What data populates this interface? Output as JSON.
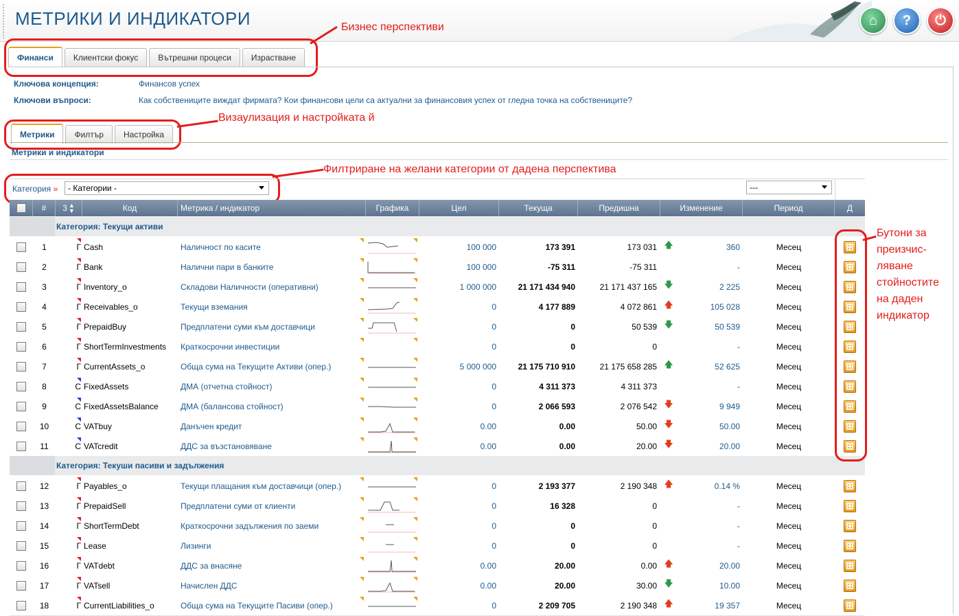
{
  "page": {
    "title": "МЕТРИКИ И ИНДИКАТОРИ"
  },
  "header_buttons": [
    {
      "name": "home",
      "glyph": "⌂"
    },
    {
      "name": "help",
      "glyph": "?"
    },
    {
      "name": "power",
      "glyph": "⏻"
    }
  ],
  "annotations": {
    "perspectives": "Бизнес перспективи",
    "visualization": "Визаулизация и настройката й",
    "filtering": "Филтриране на желани категории от дадена перспектива",
    "buttons_note": [
      "Бутони за",
      "преизчис-",
      "ляване",
      "стойностите",
      "на даден",
      "индикатор"
    ]
  },
  "perspective_tabs": [
    "Финанси",
    "Клиентски фокус",
    "Вътрешни процеси",
    "Израстване"
  ],
  "concept": {
    "key_label": "Ключова концепция:",
    "key_value": "Финансов успех",
    "questions_label": "Ключови въпроси:",
    "questions_value": "Как собствениците виждат фирмата? Кои финансови цели са актуални за финансовия успех от гледна точка на собствениците?"
  },
  "view_tabs": [
    "Метрики",
    "Филтър",
    "Настройка"
  ],
  "section_title": "Метрики и индикатори",
  "filter": {
    "label": "Категория",
    "arrow": "»",
    "category_value": "- Категории -",
    "right_value": "---"
  },
  "columns": [
    "#",
    "3",
    "Код",
    "Метрика / индикатор",
    "Графика",
    "Цел",
    "Текуща",
    "Предишна",
    "Изменение",
    "Период",
    "Д"
  ],
  "categories": [
    {
      "label": "Категория: Текущи активи",
      "rows": [
        {
          "n": "1",
          "t": "Г",
          "code": "Cash",
          "name": "Наличност по касите",
          "target": "100 000",
          "cur": "173 391",
          "prev": "173 031",
          "dir": "up",
          "chg": "360",
          "period": "Месец",
          "tri": "r",
          "spark": "cash"
        },
        {
          "n": "2",
          "t": "Г",
          "code": "Bank",
          "name": "Налични пари в банките",
          "target": "100 000",
          "cur": "-75 311",
          "prev": "-75 311",
          "dir": "",
          "chg": "-",
          "period": "Месец",
          "tri": "r",
          "spark": "bank"
        },
        {
          "n": "3",
          "t": "Г",
          "code": "Inventory_o",
          "name": "Складови Наличности (оперативни)",
          "target": "1 000 000",
          "cur": "21 171 434 940",
          "prev": "21 171 437 165",
          "dir": "down",
          "chg": "2 225",
          "period": "Месец",
          "tri": "r",
          "spark": "flat"
        },
        {
          "n": "4",
          "t": "Г",
          "code": "Receivables_o",
          "name": "Текущи вземания",
          "target": "0",
          "cur": "4 177 889",
          "prev": "4 072 861",
          "dir": "upred",
          "chg": "105 028",
          "period": "Месец",
          "tri": "r",
          "spark": "rise"
        },
        {
          "n": "5",
          "t": "Г",
          "code": "PrepaidBuy",
          "name": "Предплатени суми към доставчици",
          "target": "0",
          "cur": "0",
          "prev": "50 539",
          "dir": "down",
          "chg": "50 539",
          "period": "Месец",
          "tri": "r",
          "spark": "drop"
        },
        {
          "n": "6",
          "t": "Г",
          "code": "ShortTermInvestments",
          "name": "Краткосрочни инвестиции",
          "target": "0",
          "cur": "0",
          "prev": "0",
          "dir": "",
          "chg": "-",
          "period": "Месец",
          "tri": "r",
          "spark": "none"
        },
        {
          "n": "7",
          "t": "Г",
          "code": "CurrentAssets_o",
          "name": "Обща сума на Текущите Активи (опер.)",
          "target": "5 000 000",
          "cur": "21 175 710 910",
          "prev": "21 175 658 285",
          "dir": "up",
          "chg": "52 625",
          "period": "Месец",
          "tri": "r",
          "spark": "flat"
        },
        {
          "n": "8",
          "t": "С",
          "code": "FixedAssets",
          "name": "ДМА (отчетна стойност)",
          "target": "0",
          "cur": "4 311 373",
          "prev": "4 311 373",
          "dir": "",
          "chg": "-",
          "period": "Месец",
          "tri": "b",
          "spark": "flat"
        },
        {
          "n": "9",
          "t": "С",
          "code": "FixedAssetsBalance",
          "name": "ДМА (балансова стойност)",
          "target": "0",
          "cur": "2 066 593",
          "prev": "2 076 542",
          "dir": "downred",
          "chg": "9 949",
          "period": "Месец",
          "tri": "b",
          "spark": "flat2"
        },
        {
          "n": "10",
          "t": "С",
          "code": "VATbuy",
          "name": "Данъчен кредит",
          "target": "0.00",
          "cur": "0.00",
          "prev": "50.00",
          "dir": "downred",
          "chg": "50.00",
          "period": "Месец",
          "tri": "b",
          "spark": "peak"
        },
        {
          "n": "11",
          "t": "С",
          "code": "VATcredit",
          "name": "ДДС за възстановяване",
          "target": "0.00",
          "cur": "0.00",
          "prev": "20.00",
          "dir": "downred",
          "chg": "20.00",
          "period": "Месец",
          "tri": "b",
          "spark": "spike"
        }
      ]
    },
    {
      "label": "Категория: Текуши пасиви и задължения",
      "rows": [
        {
          "n": "12",
          "t": "Г",
          "code": "Payables_o",
          "name": "Текущи плащания към доставчици (опер.)",
          "target": "0",
          "cur": "2 193 377",
          "prev": "2 190 348",
          "dir": "upred",
          "chg": "0.14 %",
          "period": "Месец",
          "tri": "r",
          "spark": "flat"
        },
        {
          "n": "13",
          "t": "Г",
          "code": "PrepaidSell",
          "name": "Предплатени суми от клиенти",
          "target": "0",
          "cur": "16 328",
          "prev": "0",
          "dir": "",
          "chg": "-",
          "period": "Месец",
          "tri": "r",
          "spark": "bump"
        },
        {
          "n": "14",
          "t": "Г",
          "code": "ShortTermDebt",
          "name": "Краткосрочни задължения по заеми",
          "target": "0",
          "cur": "0",
          "prev": "0",
          "dir": "",
          "chg": "-",
          "period": "Месец",
          "tri": "r",
          "spark": "short"
        },
        {
          "n": "15",
          "t": "Г",
          "code": "Lease",
          "name": "Лизинги",
          "target": "0",
          "cur": "0",
          "prev": "0",
          "dir": "",
          "chg": "-",
          "period": "Месец",
          "tri": "r",
          "spark": "short"
        },
        {
          "n": "16",
          "t": "Г",
          "code": "VATdebt",
          "name": "ДДС за внасяне",
          "target": "0.00",
          "cur": "20.00",
          "prev": "0.00",
          "dir": "upred",
          "chg": "20.00",
          "period": "Месец",
          "tri": "r",
          "spark": "spike"
        },
        {
          "n": "17",
          "t": "Г",
          "code": "VATsell",
          "name": "Начислен ДДС",
          "target": "0.00",
          "cur": "20.00",
          "prev": "30.00",
          "dir": "down",
          "chg": "10.00",
          "period": "Месец",
          "tri": "r",
          "spark": "peak"
        },
        {
          "n": "18",
          "t": "Г",
          "code": "CurrentLiabilities_o",
          "name": "Обща сума на Текущите Пасиви (опер.)",
          "target": "0",
          "cur": "2 209 705",
          "prev": "2 190 348",
          "dir": "upred",
          "chg": "19 357",
          "period": "Месец",
          "tri": "r",
          "spark": "flat"
        }
      ]
    }
  ]
}
